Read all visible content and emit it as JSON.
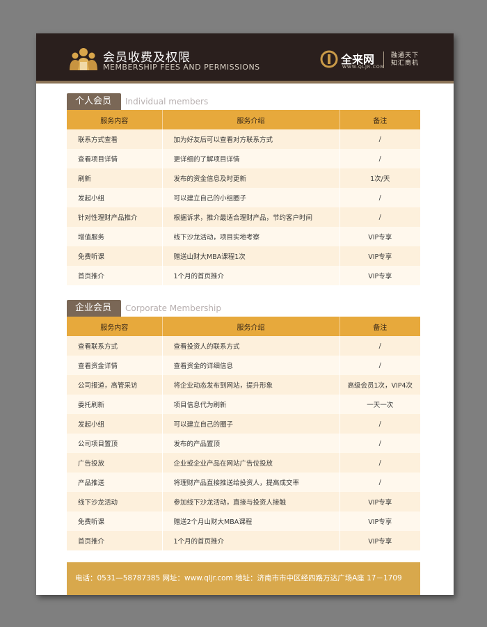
{
  "header": {
    "title": "会员收费及权限",
    "subtitle": "MEMBERSHIP FEES AND PERMISSIONS",
    "brand_name": "全来网",
    "brand_url": "WWW.QLJR.COM",
    "slogan_line1": "融通天下",
    "slogan_line2": "知汇商机"
  },
  "individual": {
    "tab_label": "个人会员",
    "en_label": "Individual members",
    "columns": [
      "服务内容",
      "服务介绍",
      "备注"
    ],
    "rows": [
      [
        "联系方式查看",
        "加为好友后可以查看对方联系方式",
        "/"
      ],
      [
        "查看项目详情",
        "更详细的了解项目详情",
        "/"
      ],
      [
        "刷新",
        "发布的资金信息及时更新",
        "1次/天"
      ],
      [
        "发起小组",
        "可以建立自己的小组圈子",
        "/"
      ],
      [
        "针对性理财产品推介",
        "根据诉求，推介最适合理财产品，节约客户时间",
        "/"
      ],
      [
        "增值服务",
        "线下沙龙活动，项目实地考察",
        "VIP专享"
      ],
      [
        "免费听课",
        "赠送山财大MBA课程1次",
        "VIP专享"
      ],
      [
        "首页推介",
        "1个月的首页推介",
        "VIP专享"
      ]
    ]
  },
  "corporate": {
    "tab_label": "企业会员",
    "en_label": "Corporate Membership",
    "columns": [
      "服务内容",
      "服务介绍",
      "备注"
    ],
    "rows": [
      [
        "查看联系方式",
        "查看投资人的联系方式",
        "/"
      ],
      [
        "查看资金详情",
        "查看资金的详细信息",
        "/"
      ],
      [
        "公司报道，高管采访",
        "将企业动态发布到网站，提升形象",
        "高级会员1次，VIP4次"
      ],
      [
        "委托刷新",
        "项目信息代为刷新",
        "一天一次"
      ],
      [
        "发起小组",
        "可以建立自己的圈子",
        "/"
      ],
      [
        "公司项目置顶",
        "发布的产品置顶",
        "/"
      ],
      [
        "广告投放",
        "企业或企业产品在网站广告位投放",
        "/"
      ],
      [
        "产品推送",
        "将理财产品直接推送给投资人，提高成交率",
        "/"
      ],
      [
        "线下沙龙活动",
        "参加线下沙龙活动，直接与投资人接触",
        "VIP专享"
      ],
      [
        "免费听课",
        "赠送2个月山财大MBA课程",
        "VIP专享"
      ],
      [
        "首页推介",
        "1个月的首页推介",
        "VIP专享"
      ]
    ]
  },
  "footer": {
    "text": "电话：0531—58787385    网址：www.qljr.com    地址：济南市市中区经四路万达广场A座 17－1709"
  },
  "colors": {
    "header_bg": "#2a1f1d",
    "accent_orange": "#e7a93c",
    "tab_brown": "#7a6756",
    "footer_gold": "#d8a84c",
    "row_odd": "#fdf0dc",
    "row_even": "#fff8ed"
  },
  "icons": [
    "members-icon",
    "brand-logo-icon"
  ]
}
